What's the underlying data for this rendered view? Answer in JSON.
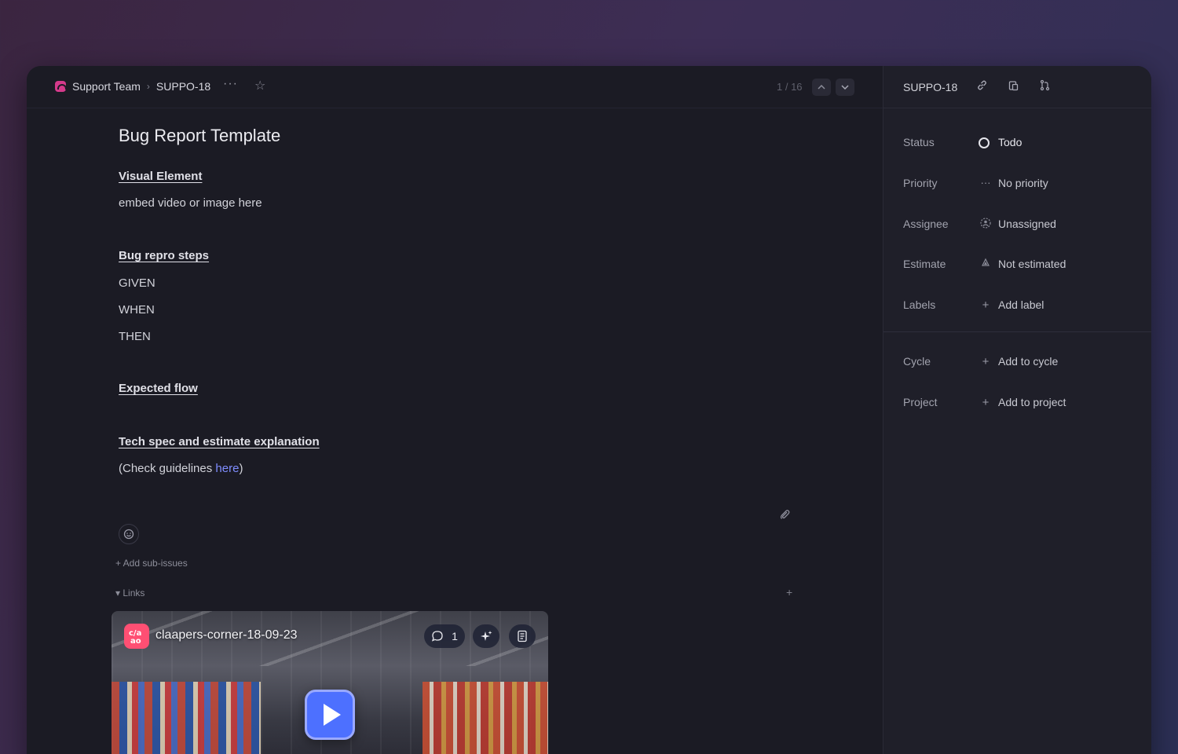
{
  "breadcrumb": {
    "team": "Support Team",
    "issue_id": "SUPPO-18",
    "separator": "›"
  },
  "header": {
    "more": "···",
    "star": "☆",
    "pager": "1 / 16",
    "up": "⌃",
    "down": "⌄"
  },
  "issue": {
    "title": "Bug Report Template",
    "sections": {
      "visual_heading": "Visual Element",
      "visual_text": "embed video or image here",
      "repro_heading": "Bug repro steps",
      "given": "GIVEN",
      "when": "WHEN",
      "then": "THEN",
      "expected_heading": "Expected flow",
      "tech_heading": "Tech spec and estimate explanation",
      "check_prefix": "(Check guidelines ",
      "check_link": "here",
      "check_suffix": ")"
    },
    "add_sub_issues": "+ Add sub-issues",
    "links_toggle": "▾ Links",
    "links_add": "+"
  },
  "video": {
    "logo_text": "c/a\nao",
    "title": "claapers-corner-18-09-23",
    "comment_count": "1"
  },
  "sidebar": {
    "issue_id": "SUPPO-18",
    "properties": [
      {
        "label": "Status",
        "icon": "circle-icon",
        "value": "Todo"
      },
      {
        "label": "Priority",
        "icon": "dots-icon",
        "value": "No priority"
      },
      {
        "label": "Assignee",
        "icon": "user-icon",
        "value": "Unassigned"
      },
      {
        "label": "Estimate",
        "icon": "triangle-icon",
        "value": "Not estimated"
      },
      {
        "label": "Labels",
        "icon": "plus-icon",
        "value": "Add label"
      },
      {
        "label": "Cycle",
        "icon": "plus-icon",
        "value": "Add to cycle"
      },
      {
        "label": "Project",
        "icon": "plus-icon",
        "value": "Add to project"
      }
    ]
  },
  "colors": {
    "accent": "#7f8dff",
    "play": "#4d70ff",
    "team": "#d43a8b"
  }
}
